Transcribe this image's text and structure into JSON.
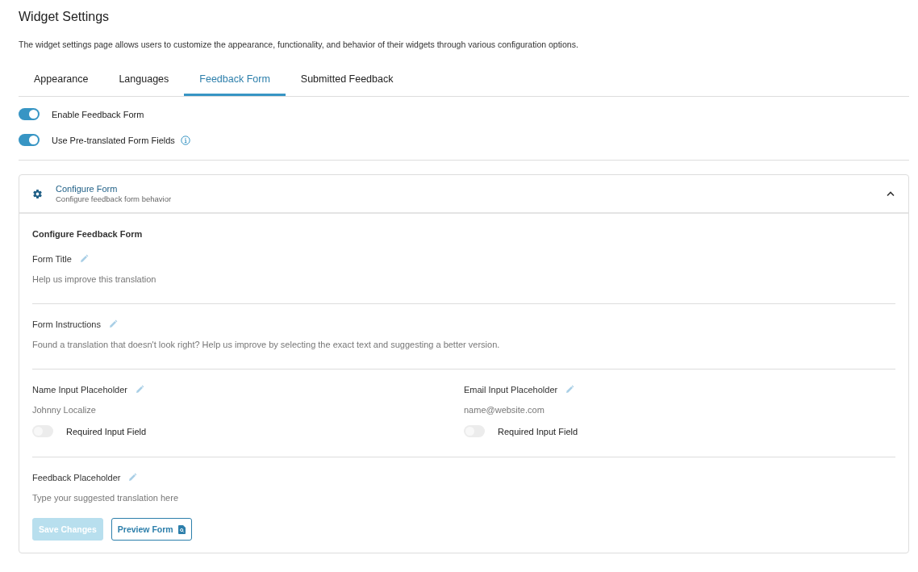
{
  "page": {
    "title": "Widget Settings",
    "description": "The widget settings page allows users to customize the appearance, functionality, and behavior of their widgets through various configuration options."
  },
  "tabs": [
    {
      "label": "Appearance",
      "selected": false
    },
    {
      "label": "Languages",
      "selected": false
    },
    {
      "label": "Feedback Form",
      "selected": true
    },
    {
      "label": "Submitted Feedback",
      "selected": false
    }
  ],
  "toggles": [
    {
      "label": "Enable Feedback Form",
      "on": true,
      "info": false
    },
    {
      "label": "Use Pre-translated Form Fields",
      "on": true,
      "info": true
    }
  ],
  "panel": {
    "title": "Configure Form",
    "subtitle": "Configure feedback form behavior",
    "expanded": true,
    "heading": "Configure Feedback Form",
    "sections": [
      {
        "fields": [
          {
            "label": "Form Title",
            "value": "Help us improve this translation"
          }
        ]
      },
      {
        "fields": [
          {
            "label": "Form Instructions",
            "value": "Found a translation that doesn't look right? Help us improve by selecting the exact text and suggesting a better version."
          }
        ]
      },
      {
        "fields": [
          {
            "label": "Name Input Placeholder",
            "value": "Johnny Localize",
            "required": {
              "label": "Required Input Field",
              "on": false
            }
          },
          {
            "label": "Email Input Placeholder",
            "value": "name@website.com",
            "required": {
              "label": "Required Input Field",
              "on": false
            }
          }
        ]
      },
      {
        "fields": [
          {
            "label": "Feedback Placeholder",
            "value": "Type your suggested translation here"
          }
        ]
      }
    ],
    "buttons": [
      {
        "label": "Save Changes",
        "kind": "primary",
        "disabled": true
      },
      {
        "label": "Preview Form",
        "kind": "outline",
        "disabled": false
      }
    ]
  }
}
